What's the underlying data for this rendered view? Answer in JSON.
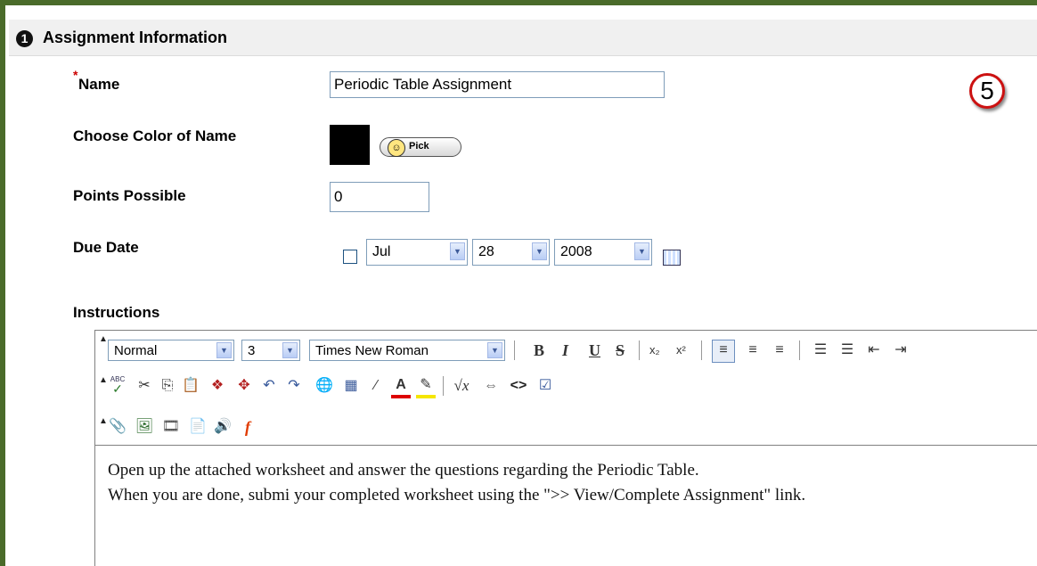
{
  "section": {
    "step": "1",
    "title": "Assignment Information"
  },
  "callout": "5",
  "form": {
    "required_mark": "*",
    "name_label": "Name",
    "name_value": "Periodic Table Assignment",
    "color_label": "Choose Color of Name",
    "color_value": "#000000",
    "pick_label": "Pick",
    "points_label": "Points Possible",
    "points_value": "0",
    "due_label": "Due Date",
    "due_enabled": false,
    "due_month": "Jul",
    "due_day": "28",
    "due_year": "2008"
  },
  "instructions": {
    "label": "Instructions",
    "toolbar": {
      "format_value": "Normal",
      "size_value": "3",
      "font_value": "Times New Roman",
      "bold": "B",
      "italic": "I",
      "underline": "U",
      "strike": "S",
      "subscript": "x₂",
      "superscript": "x²",
      "spell_abc": "ABC",
      "html_code": "<>",
      "flash": "f"
    },
    "body_lines": [
      "Open up the attached worksheet and answer the questions regarding the Periodic Table.",
      "When you are done, submi your completed worksheet using the \">> View/Complete Assignment\" link."
    ]
  },
  "colors": {
    "frame": "#4a6b2a",
    "header_bg": "#f0f0f0",
    "required": "#cc0000",
    "callout_ring": "#cc1111"
  }
}
